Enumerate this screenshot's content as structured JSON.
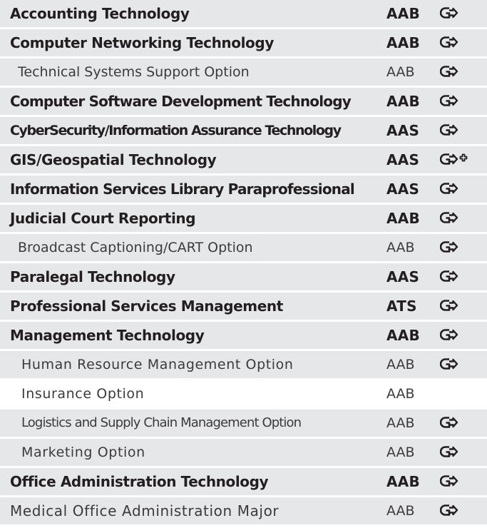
{
  "rows": [
    {
      "program": "Accounting Technology",
      "degree": "AAB",
      "kind": "main",
      "icon": "gainful-employment-icon"
    },
    {
      "program": "Computer Networking Technology",
      "degree": "AAB",
      "kind": "main",
      "icon": "gainful-employment-icon"
    },
    {
      "program": "Technical Systems Support Option",
      "degree": "AAB",
      "kind": "sub",
      "icon": "gainful-employment-icon"
    },
    {
      "program": "Computer Software Development Technology",
      "degree": "AAB",
      "kind": "main",
      "icon": "gainful-employment-icon"
    },
    {
      "program": "CyberSecurity/Information Assurance Technology",
      "degree": "AAS",
      "kind": "main",
      "icon": "gainful-employment-icon"
    },
    {
      "program": "GIS/Geospatial Technology",
      "degree": "AAS",
      "kind": "main",
      "icon": "gainful-employment-plus-icon"
    },
    {
      "program": "Information Services Library Paraprofessional",
      "degree": "AAS",
      "kind": "main",
      "icon": "gainful-employment-icon"
    },
    {
      "program": "Judicial Court Reporting",
      "degree": "AAB",
      "kind": "main",
      "icon": "gainful-employment-icon"
    },
    {
      "program": "Broadcast Captioning/CART Option",
      "degree": "AAB",
      "kind": "sub",
      "icon": "gainful-employment-icon"
    },
    {
      "program": "Paralegal Technology",
      "degree": "AAS",
      "kind": "main",
      "icon": "gainful-employment-icon"
    },
    {
      "program": "Professional Services Management",
      "degree": "ATS",
      "kind": "main",
      "icon": "gainful-employment-icon"
    },
    {
      "program": "Management Technology",
      "degree": "AAB",
      "kind": "main",
      "icon": "gainful-employment-icon"
    },
    {
      "program": "Human Resource Management Option",
      "degree": "AAB",
      "kind": "sub",
      "icon": "gainful-employment-icon"
    },
    {
      "program": "Insurance Option",
      "degree": "AAB",
      "kind": "sub",
      "icon": ""
    },
    {
      "program": "Logistics and Supply Chain Management  Option",
      "degree": "AAB",
      "kind": "sub",
      "icon": "gainful-employment-icon"
    },
    {
      "program": "Marketing Option",
      "degree": "AAB",
      "kind": "sub",
      "icon": "gainful-employment-icon"
    },
    {
      "program": "Office Administration Technology",
      "degree": "AAB",
      "kind": "main",
      "icon": "gainful-employment-icon"
    },
    {
      "program": "Medical Office Administration Major",
      "degree": "AAB",
      "kind": "sub",
      "icon": "gainful-employment-icon"
    }
  ],
  "colors": {
    "row_bg": "#e6e7e8",
    "text": "#231f20"
  }
}
